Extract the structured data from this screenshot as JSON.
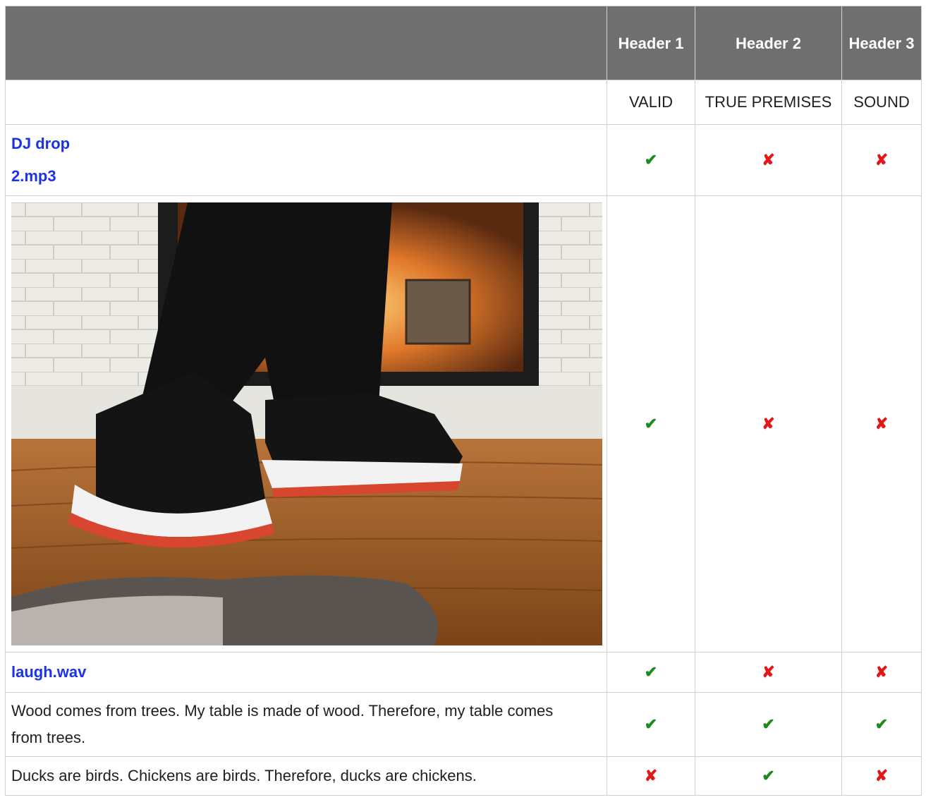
{
  "table": {
    "headers": [
      "",
      "Header 1",
      "Header 2",
      "Header 3"
    ],
    "subheaders": [
      "",
      "VALID",
      "TRUE PREMISES",
      "SOUND"
    ],
    "rows": [
      {
        "label": "DJ drop 2.mp3",
        "marks": [
          "✔",
          "✘",
          "✘"
        ],
        "kinds": [
          "ok",
          "bad",
          "bad"
        ]
      },
      {
        "label": "",
        "marks": [
          "✔",
          "✘",
          "✘"
        ],
        "kinds": [
          "ok",
          "bad",
          "bad"
        ]
      },
      {
        "label": "laugh.wav",
        "marks": [
          "✔",
          "✘",
          "✘"
        ],
        "kinds": [
          "ok",
          "bad",
          "bad"
        ]
      },
      {
        "label": "Wood comes from trees. My table is made of wood. Therefore, my table comes from trees.",
        "marks": [
          "✔",
          "✔",
          "✔"
        ],
        "kinds": [
          "ok",
          "ok",
          "ok"
        ]
      },
      {
        "label": "Ducks are birds. Chickens are birds. Therefore, ducks are chickens.",
        "marks": [
          "✘",
          "✔",
          "✘"
        ],
        "kinds": [
          "bad",
          "ok",
          "bad"
        ]
      }
    ]
  },
  "colors": {
    "header_bg": "#6f6f6f",
    "check": "#1e8a1e",
    "cross": "#e01818",
    "link": "#1a33e6"
  },
  "icons": {
    "check": "check-mark-icon",
    "cross": "cross-mark-icon"
  }
}
